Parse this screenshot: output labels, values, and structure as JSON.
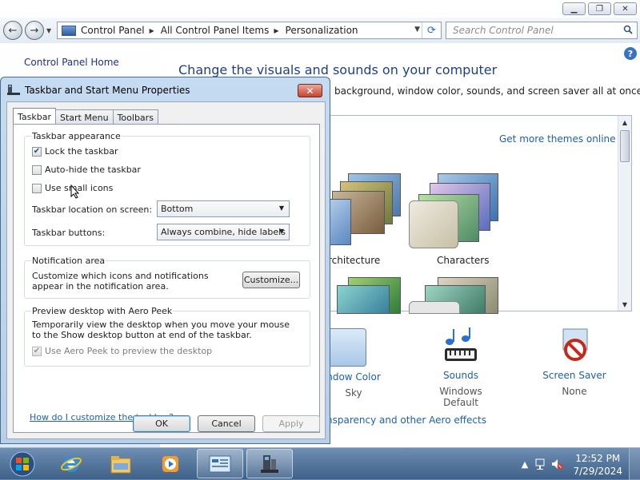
{
  "explorer": {
    "nav": {
      "back_icon": "back-arrow-icon",
      "forward_icon": "forward-arrow-icon"
    },
    "breadcrumbs": [
      "Control Panel",
      "All Control Panel Items",
      "Personalization"
    ],
    "search_placeholder": "Search Control Panel",
    "sidebar_link": "Control Panel Home",
    "title": "Change the visuals and sounds on your computer",
    "subtitle": "background, window color, sounds, and screen saver all at once.",
    "get_more_themes": "Get more themes online",
    "themes": [
      {
        "label": "rchitecture"
      },
      {
        "label": "Characters"
      }
    ],
    "bottom": {
      "window_color": {
        "label": "ndow Color",
        "value": "Sky"
      },
      "sounds": {
        "label": "Sounds",
        "value": "Windows Default"
      },
      "screen_saver": {
        "label": "Screen Saver",
        "value": "None"
      }
    },
    "aero_link": "nsparency and other Aero effects"
  },
  "dialog": {
    "title": "Taskbar and Start Menu Properties",
    "tabs": [
      "Taskbar",
      "Start Menu",
      "Toolbars"
    ],
    "active_tab": "Taskbar",
    "appearance": {
      "label": "Taskbar appearance",
      "lock": {
        "label": "Lock the taskbar",
        "checked": true
      },
      "autohide": {
        "label": "Auto-hide the taskbar",
        "checked": false
      },
      "small_icons": {
        "label": "Use small icons",
        "checked": false
      },
      "location_label": "Taskbar location on screen:",
      "location_value": "Bottom",
      "buttons_label": "Taskbar buttons:",
      "buttons_value": "Always combine, hide labels"
    },
    "notification": {
      "label": "Notification area",
      "text": "Customize which icons and notifications appear in the notification area.",
      "customize_button": "Customize..."
    },
    "peek": {
      "label": "Preview desktop with Aero Peek",
      "text": "Temporarily view the desktop when you move your mouse to the Show desktop button at end of the taskbar.",
      "checkbox": {
        "label": "Use Aero Peek to preview the desktop",
        "checked": true,
        "disabled": true
      }
    },
    "help_link": "How do I customize the taskbar?",
    "buttons": {
      "ok": "OK",
      "cancel": "Cancel",
      "apply": "Apply"
    }
  },
  "taskbar": {
    "time": "12:52 PM",
    "date": "7/29/2024"
  },
  "colors": {
    "link": "#1e5fb4",
    "title": "#1e3f8c",
    "taskbar": "#4f709a"
  }
}
